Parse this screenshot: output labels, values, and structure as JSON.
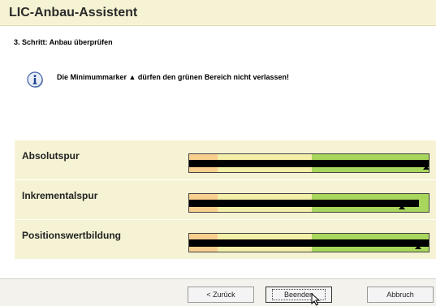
{
  "window": {
    "title": "LIC-Anbau-Assistent"
  },
  "step": {
    "label": "3. Schritt: Anbau überprüfen"
  },
  "info": {
    "icon": "info-icon",
    "message": "Die Minimummarker ▲ dürfen den grünen Bereich nicht verlassen!"
  },
  "colors": {
    "panel": "#f6f3d4",
    "zone_orange": "#f9cf8f",
    "zone_yellow": "#f4efa8",
    "zone_green": "#a9d65c"
  },
  "tracks": [
    {
      "label": "Absolutspur",
      "fill": 1.0,
      "min_marker": 1.0
    },
    {
      "label": "Inkrementalspur",
      "fill": 0.96,
      "min_marker": 0.89
    },
    {
      "label": "Positionswertbildung",
      "fill": 1.0,
      "min_marker": 0.96
    }
  ],
  "buttons": {
    "back": "< Zurück",
    "finish": "Beenden",
    "cancel": "Abbruch"
  }
}
